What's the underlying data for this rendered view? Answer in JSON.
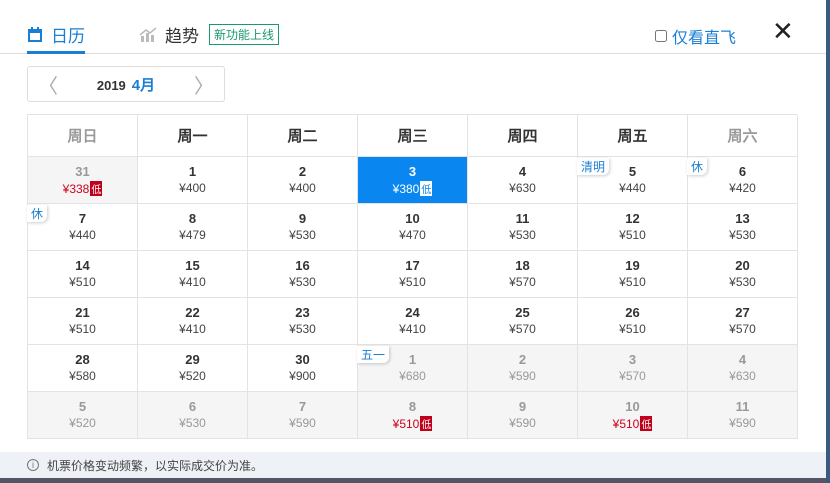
{
  "tabs": {
    "calendar": "日历",
    "trend": "趋势",
    "new_badge": "新功能上线"
  },
  "direct_only": "仅看直飞",
  "close": "✕",
  "nav": {
    "year": "2019",
    "month": "4月",
    "prev": "〈",
    "next": "〉"
  },
  "weekdays": [
    "周日",
    "周一",
    "周二",
    "周三",
    "周四",
    "周五",
    "周六"
  ],
  "low_label": "低",
  "days": [
    {
      "d": "31",
      "p": "¥338",
      "other": true,
      "low": true
    },
    {
      "d": "1",
      "p": "¥400"
    },
    {
      "d": "2",
      "p": "¥400"
    },
    {
      "d": "3",
      "p": "¥380",
      "low": true,
      "selected": true
    },
    {
      "d": "4",
      "p": "¥630"
    },
    {
      "d": "5",
      "p": "¥440",
      "tag": "清明"
    },
    {
      "d": "6",
      "p": "¥420",
      "tag": "休"
    },
    {
      "d": "7",
      "p": "¥440",
      "tag": "休"
    },
    {
      "d": "8",
      "p": "¥479"
    },
    {
      "d": "9",
      "p": "¥530"
    },
    {
      "d": "10",
      "p": "¥470"
    },
    {
      "d": "11",
      "p": "¥530"
    },
    {
      "d": "12",
      "p": "¥510"
    },
    {
      "d": "13",
      "p": "¥530"
    },
    {
      "d": "14",
      "p": "¥510"
    },
    {
      "d": "15",
      "p": "¥410"
    },
    {
      "d": "16",
      "p": "¥530"
    },
    {
      "d": "17",
      "p": "¥510"
    },
    {
      "d": "18",
      "p": "¥570"
    },
    {
      "d": "19",
      "p": "¥510"
    },
    {
      "d": "20",
      "p": "¥530"
    },
    {
      "d": "21",
      "p": "¥510"
    },
    {
      "d": "22",
      "p": "¥410"
    },
    {
      "d": "23",
      "p": "¥530"
    },
    {
      "d": "24",
      "p": "¥410"
    },
    {
      "d": "25",
      "p": "¥570"
    },
    {
      "d": "26",
      "p": "¥510"
    },
    {
      "d": "27",
      "p": "¥570"
    },
    {
      "d": "28",
      "p": "¥580"
    },
    {
      "d": "29",
      "p": "¥520"
    },
    {
      "d": "30",
      "p": "¥900"
    },
    {
      "d": "1",
      "p": "¥680",
      "other": true,
      "tag": "五一"
    },
    {
      "d": "2",
      "p": "¥590",
      "other": true
    },
    {
      "d": "3",
      "p": "¥570",
      "other": true
    },
    {
      "d": "4",
      "p": "¥630",
      "other": true
    },
    {
      "d": "5",
      "p": "¥520",
      "other": true
    },
    {
      "d": "6",
      "p": "¥530",
      "other": true
    },
    {
      "d": "7",
      "p": "¥590",
      "other": true
    },
    {
      "d": "8",
      "p": "¥510",
      "other": true,
      "low": true
    },
    {
      "d": "9",
      "p": "¥590",
      "other": true
    },
    {
      "d": "10",
      "p": "¥510",
      "other": true,
      "low": true
    },
    {
      "d": "11",
      "p": "¥590",
      "other": true
    }
  ],
  "footer": {
    "icon": "i",
    "text": "机票价格变动频繁，以实际成交价为准。"
  }
}
